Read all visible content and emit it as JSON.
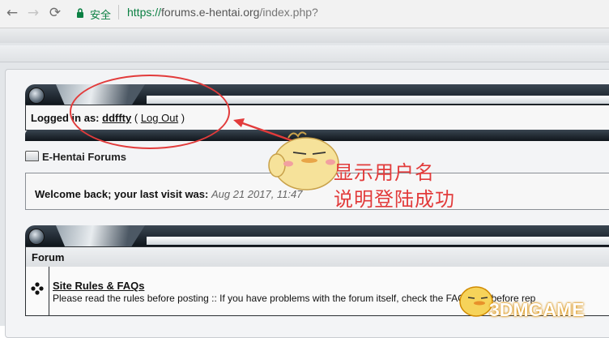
{
  "browser": {
    "secure_label": "安全",
    "url_scheme": "https://",
    "url_host": "forums.e-hentai.org",
    "url_path": "/index.php?"
  },
  "login": {
    "prefix": "Logged in as:",
    "username": "ddffty",
    "open_paren": "(",
    "logout_label": "Log Out",
    "close_paren": ")"
  },
  "breadcrumb": {
    "label": "E-Hentai Forums"
  },
  "welcome": {
    "text": "Welcome back; your last visit was:",
    "date": "Aug 21 2017, 11:47"
  },
  "forum_table": {
    "header": "Forum",
    "rows": [
      {
        "title": "Site Rules & FAQs",
        "description": "Please read the rules before posting :: If you have problems with the forum itself, check the FAQs first before rep"
      }
    ]
  },
  "annotation": {
    "line1": "显示用户名",
    "line2": "说明登陆成功",
    "color": "#e23b3b"
  },
  "watermark": {
    "text": "3DMGAME"
  }
}
